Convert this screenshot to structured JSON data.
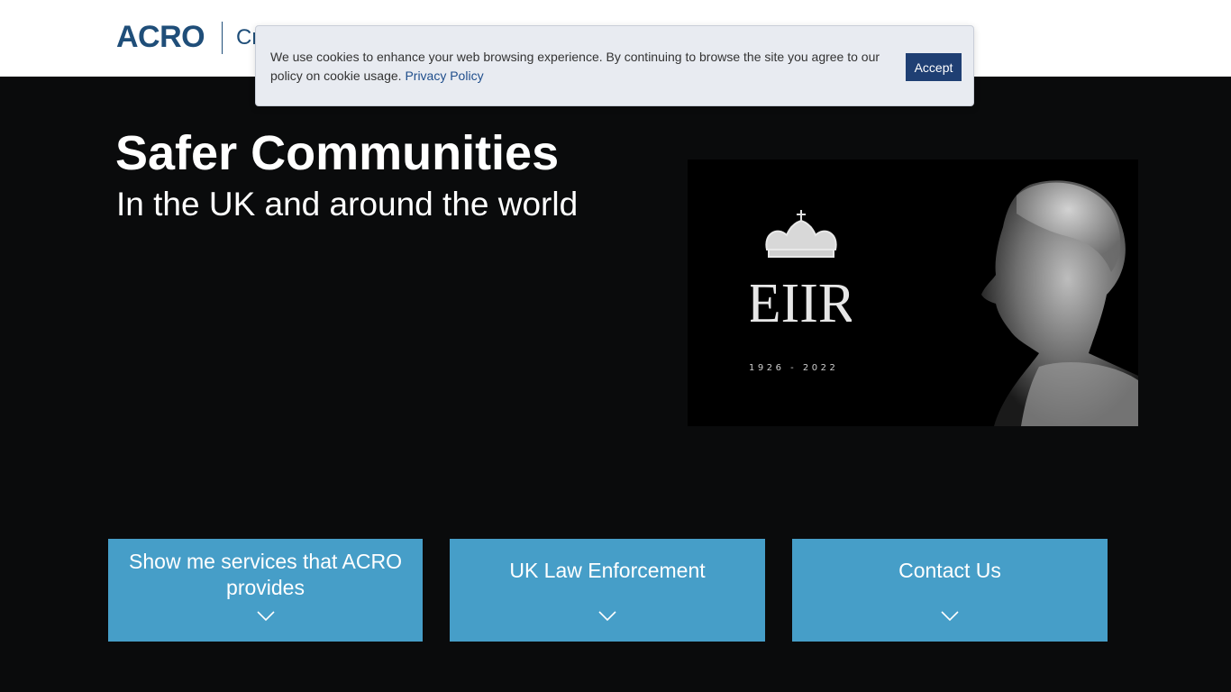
{
  "header": {
    "logo": "ACRO",
    "subtitle": "Cr"
  },
  "cookie_banner": {
    "text": "We use cookies to enhance your web browsing experience. By continuing to browse the site you agree to our policy on cookie usage.",
    "link_label": "Privacy Policy",
    "accept_label": "Accept"
  },
  "hero": {
    "title": "Safer Communities",
    "subtitle": "In the UK and around the world"
  },
  "memorial": {
    "cipher": "EIIR",
    "dates": "1926 - 2022"
  },
  "tiles": [
    {
      "label": "Show me services that ACRO provides"
    },
    {
      "label": "UK Law Enforcement"
    },
    {
      "label": "Contact Us"
    }
  ],
  "colors": {
    "brand": "#1f4e79",
    "tile": "#469ec8",
    "accept": "#1f3f73",
    "hero_bg": "#0a0b0c"
  },
  "icons": {
    "tile_chevron": "chevron-down-icon",
    "crown": "crown-icon"
  }
}
